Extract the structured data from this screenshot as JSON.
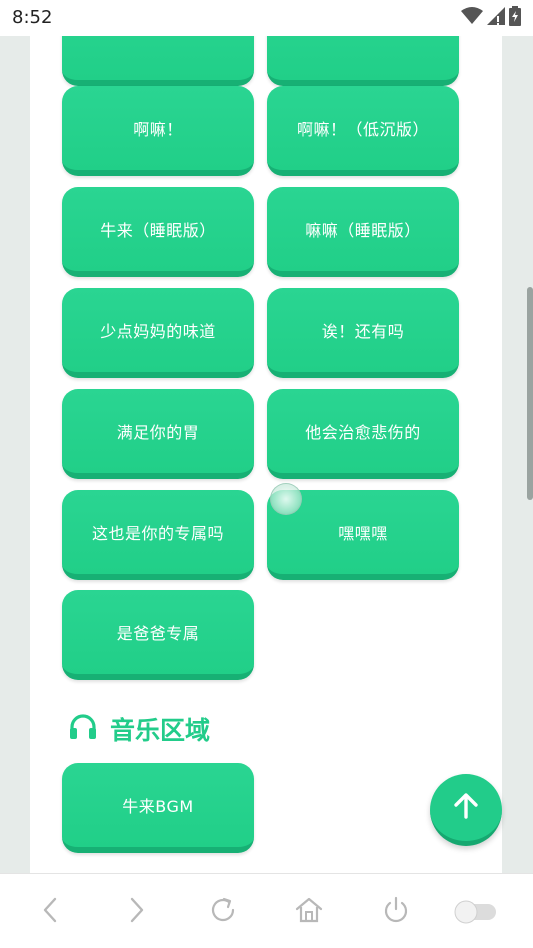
{
  "status_bar": {
    "time": "8:52"
  },
  "sound_buttons": [
    {
      "label": ""
    },
    {
      "label": ""
    },
    {
      "label": "啊嘛！"
    },
    {
      "label": "啊嘛！（低沉版）"
    },
    {
      "label": "牛来（睡眠版）"
    },
    {
      "label": "嘛嘛（睡眠版）"
    },
    {
      "label": "少点妈妈的味道"
    },
    {
      "label": "诶！还有吗"
    },
    {
      "label": "满足你的胃"
    },
    {
      "label": "他会治愈悲伤的"
    },
    {
      "label": "这也是你的专属吗"
    },
    {
      "label": "嘿嘿嘿"
    },
    {
      "label": "是爸爸专属"
    }
  ],
  "music_section": {
    "title": "音乐区域",
    "icon": "headphones-icon",
    "buttons": [
      {
        "label": "牛来BGM"
      }
    ]
  },
  "fab": {
    "icon": "arrow-up-icon"
  },
  "bottom_nav": {
    "icons": [
      "back-icon",
      "forward-icon",
      "reload-icon",
      "home-icon",
      "power-icon",
      "toggle-switch"
    ]
  },
  "colors": {
    "accent": "#22cc8a",
    "button": "#2ad592",
    "button_shadow": "#17b074",
    "page_bg": "#e6ebe9"
  }
}
